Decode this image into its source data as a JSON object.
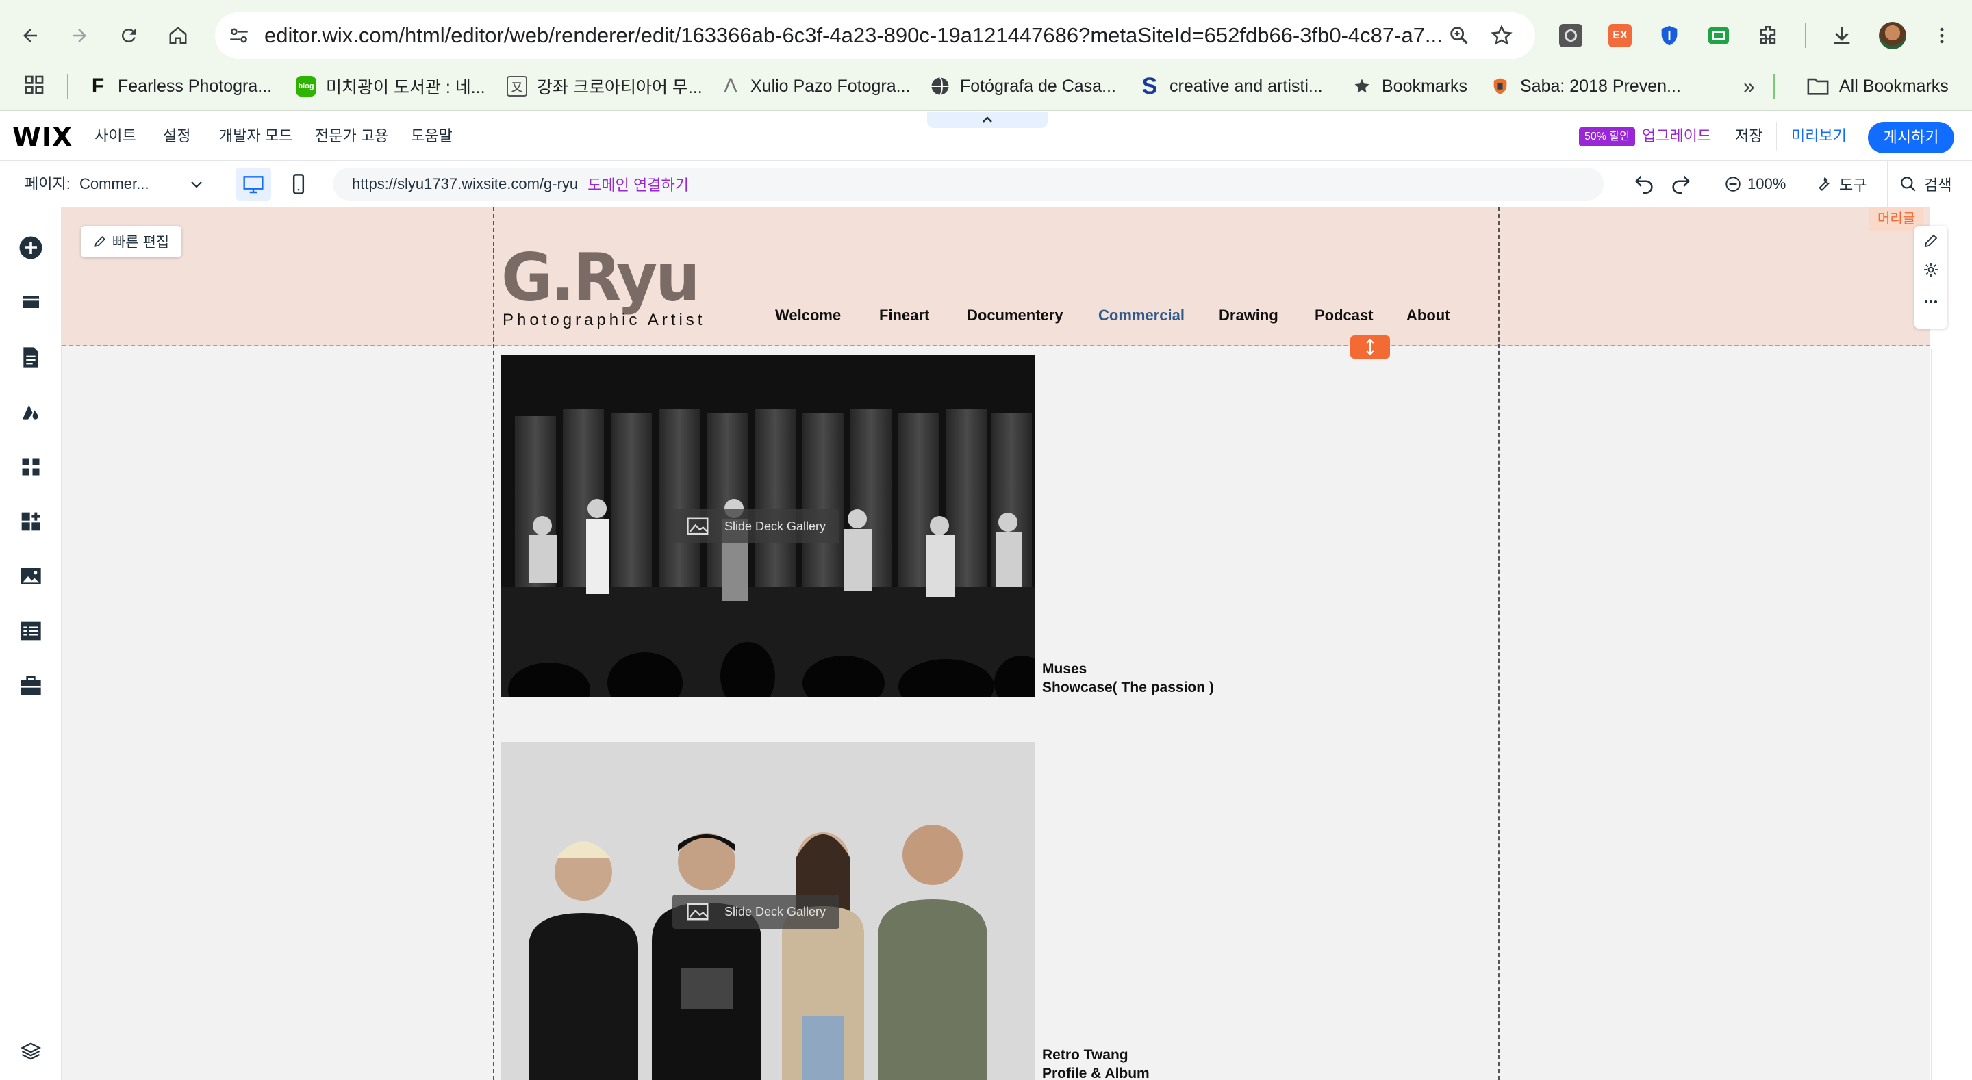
{
  "browser": {
    "url": "editor.wix.com/html/editor/web/renderer/edit/163366ab-6c3f-4a23-890c-19a121447686?metaSiteId=652fdb66-3fb0-4c87-a7...",
    "bookmarks": [
      {
        "label": "Fearless Photogra...",
        "icon": "letter-f-icon"
      },
      {
        "label": "미치광이 도서관 : 네...",
        "icon": "blog-icon"
      },
      {
        "label": "강좌 크로아티아어 무...",
        "icon": "korean-char-icon"
      },
      {
        "label": "Xulio Pazo Fotogra...",
        "icon": "lambda-icon"
      },
      {
        "label": "Fotógrafa de Casa...",
        "icon": "globe-icon"
      },
      {
        "label": "creative and artisti...",
        "icon": "letter-s-icon"
      },
      {
        "label": "Bookmarks",
        "icon": "star-icon"
      },
      {
        "label": "Saba: 2018 Preven...",
        "icon": "shield-icon"
      }
    ],
    "all_bookmarks": "All Bookmarks",
    "ext_badge": "EX"
  },
  "wix": {
    "logo": "WIX",
    "menu": [
      "사이트",
      "설정",
      "개발자 모드",
      "전문가 고용",
      "도움말"
    ],
    "promo_badge": "50% 할인",
    "upgrade": "업그레이드",
    "save": "저장",
    "preview": "미리보기",
    "publish": "게시하기",
    "page_label": "페이지:",
    "page_value": "Commer...",
    "site_url": "https://slyu1737.wixsite.com/g-ryu",
    "connect_domain": "도메인 연결하기",
    "zoom": "100%",
    "tools": "도구",
    "search": "검색"
  },
  "canvas": {
    "quick_edit": "빠른 편집",
    "header_tag": "머리글",
    "site_logo": "G.Ryu",
    "site_tagline": "Photographic Artist",
    "site_nav": [
      "Welcome",
      "Fineart",
      "Documentery",
      "Commercial",
      "Drawing",
      "Podcast",
      "About"
    ],
    "active_nav": "Commercial",
    "gallery_label": "Slide Deck Gallery",
    "items": [
      {
        "line1": "Muses",
        "line2": "Showcase( The passion )"
      },
      {
        "line1": "Retro Twang",
        "line2": "Profile & Album"
      }
    ]
  },
  "colors": {
    "wix_blue": "#116dff",
    "header_band": "#f3e1d9",
    "accent_orange": "#f36a35",
    "promo_purple": "#9a27d5",
    "nav_active": "#2f5b8a"
  }
}
